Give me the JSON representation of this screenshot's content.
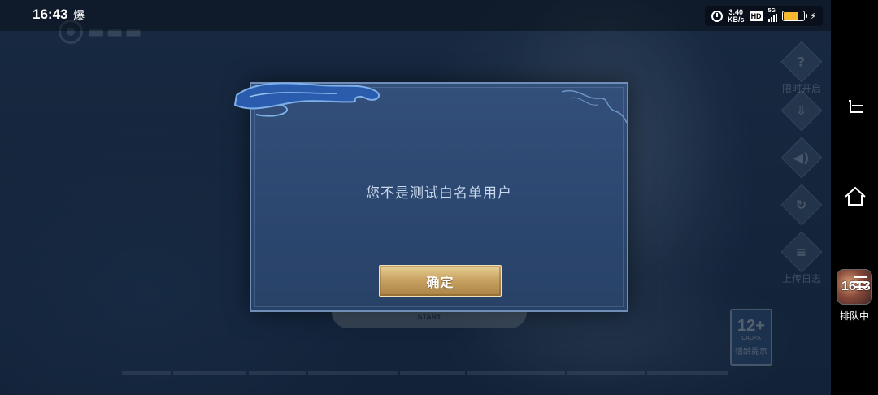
{
  "status_bar": {
    "time": "16:43",
    "extra_glyph": "爆",
    "net_speed_value": "3.40",
    "net_speed_unit": "KB/s",
    "hd_label": "HD",
    "network_type": "5G",
    "battery_level": 0.75
  },
  "game": {
    "side_icons": [
      {
        "icon": "question-icon",
        "glyph": "?",
        "label": "限时开启"
      },
      {
        "icon": "download-icon",
        "glyph": "⇩",
        "label": ""
      },
      {
        "icon": "speaker-icon",
        "glyph": "◀)",
        "label": ""
      },
      {
        "icon": "repair-icon",
        "glyph": "↻",
        "label": ""
      },
      {
        "icon": "log-icon",
        "glyph": "≡",
        "label": "上传日志"
      }
    ],
    "age_rating": {
      "age": "12+",
      "org": "CADPA",
      "hint": "适龄提示"
    },
    "start_label": "START"
  },
  "dialog": {
    "message": "您不是测试白名单用户",
    "confirm_label": "确定"
  },
  "nav": {
    "queue_app_number": "1613",
    "queue_label": "排队中"
  },
  "colors": {
    "dialog_bg": "#2c4770",
    "dialog_border": "#6f8fb8",
    "button_gold": "#c9a463",
    "message_text": "#c9d9ec"
  }
}
